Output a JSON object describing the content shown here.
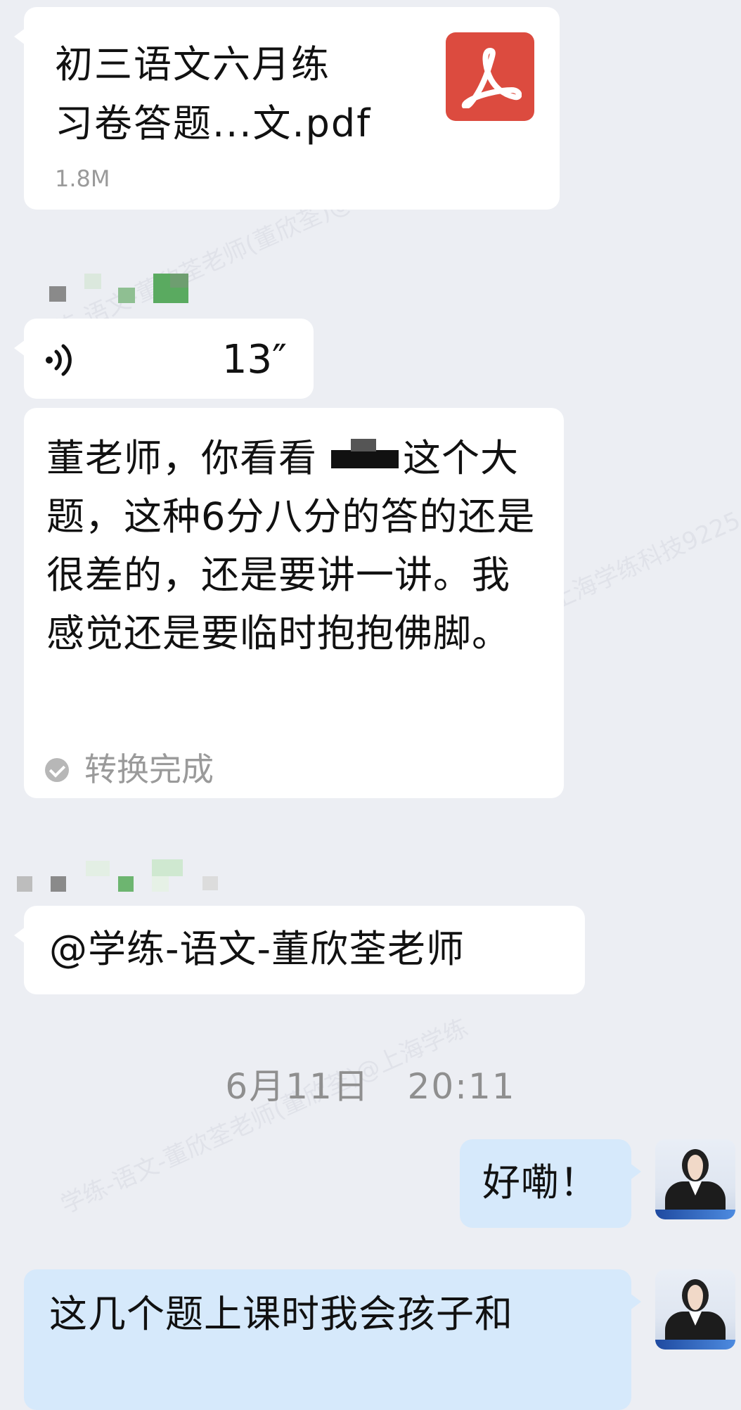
{
  "file_message": {
    "name_line1": "初三语文六月练",
    "name_line2": "习卷答题...文.pdf",
    "size": "1.8M",
    "icon": "pdf-icon",
    "icon_color": "#dc4b3f"
  },
  "voice_message": {
    "duration": "13″",
    "icon": "voice-wave-icon",
    "transcript_before": "董老师，你看看",
    "transcript_after": "这个大题，这种6分八分的答的还是很差的，还是要讲一讲。我感觉还是要临时抱抱佛脚。",
    "status": "转换完成",
    "status_icon": "check-circle-icon"
  },
  "mention_message": {
    "text": "@学练-语文-董欣荃老师"
  },
  "timestamp": "6月11日   20:11",
  "reply_messages": [
    {
      "text": "好嘞！"
    },
    {
      "text": "这几个题上课时我会孩子和"
    }
  ],
  "watermark": {
    "texts": [
      "学练-语文-董欣荃老师(董欣荃)@上海学练",
      "学练-语文-董欣荃老师(董欣荃)@上海学练科技9225"
    ]
  },
  "colors": {
    "background": "#eceef3",
    "incoming_bubble": "#ffffff",
    "outgoing_bubble": "#d6e9fb",
    "muted_text": "#9a9a9a"
  }
}
